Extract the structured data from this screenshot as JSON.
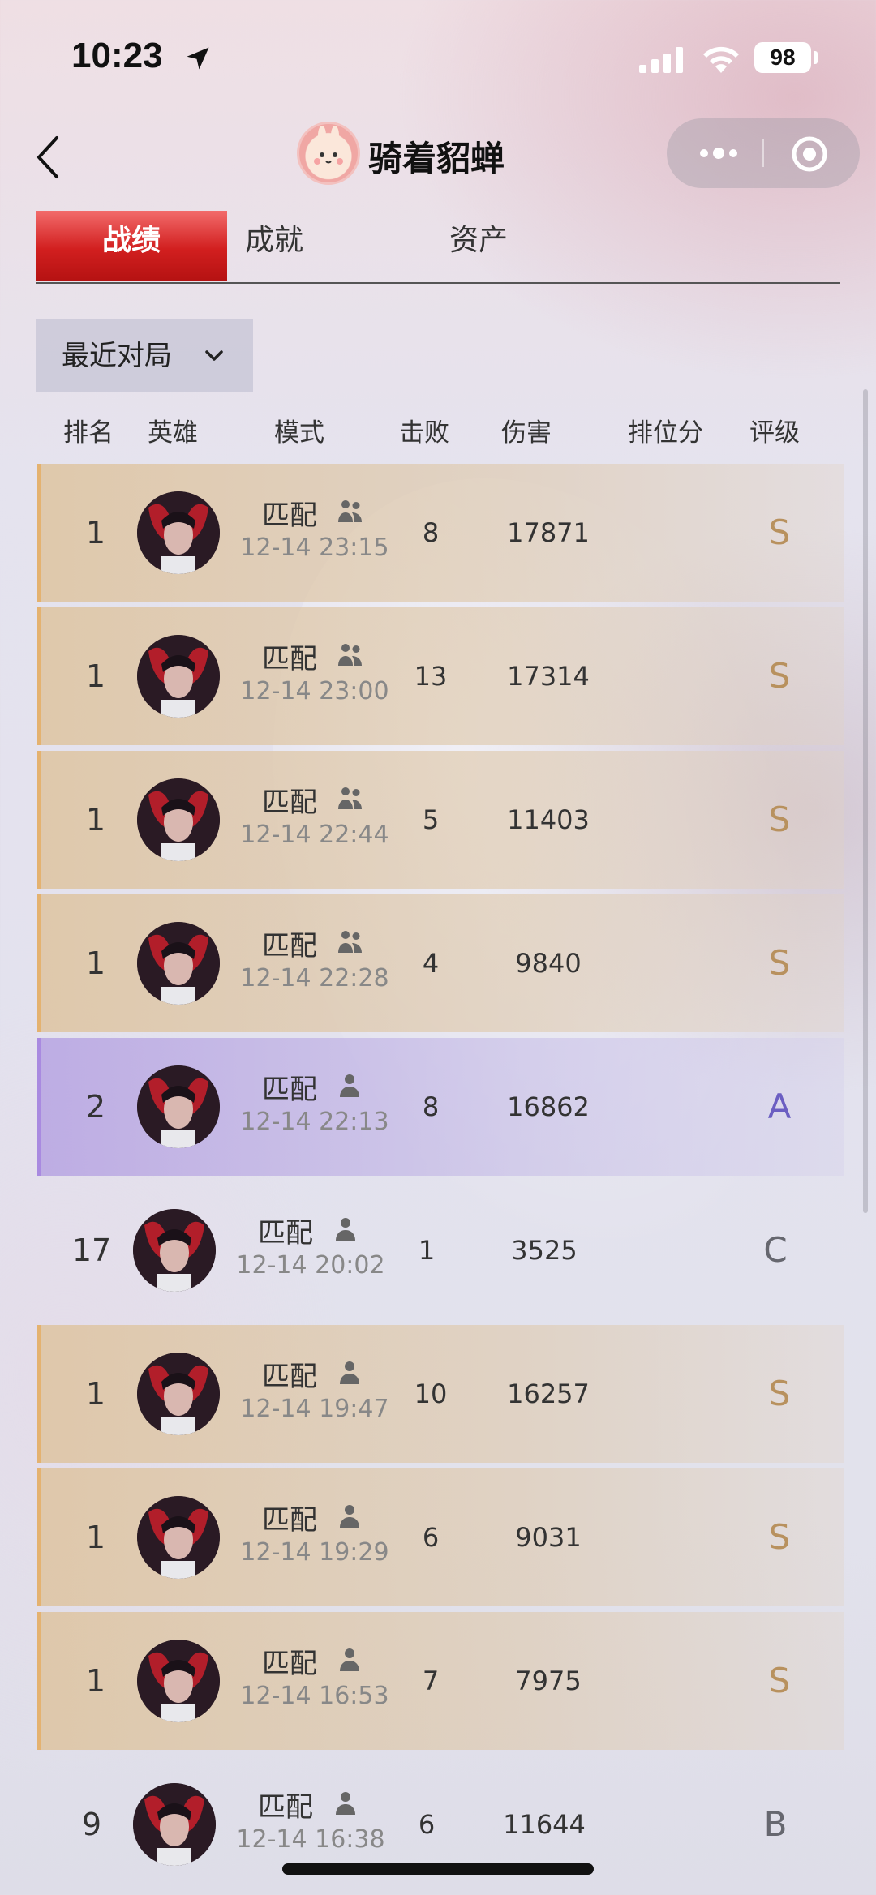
{
  "status_bar": {
    "time": "10:23",
    "battery": "98"
  },
  "nav": {
    "title": "骑着貂蝉"
  },
  "tabs": [
    "战绩",
    "成就",
    "资产"
  ],
  "filter": {
    "label": "最近对局"
  },
  "columns": {
    "rank": "排名",
    "hero": "英雄",
    "mode": "模式",
    "kills": "击败",
    "damage": "伤害",
    "rank_points": "排位分",
    "grade": "评级"
  },
  "matches": [
    {
      "rank": "1",
      "mode": "匹配",
      "team": "group",
      "time": "12-14 23:15",
      "kills": "8",
      "damage": "17871",
      "grade": "S",
      "style": "gold"
    },
    {
      "rank": "1",
      "mode": "匹配",
      "team": "group",
      "time": "12-14 23:00",
      "kills": "13",
      "damage": "17314",
      "grade": "S",
      "style": "gold"
    },
    {
      "rank": "1",
      "mode": "匹配",
      "team": "group",
      "time": "12-14 22:44",
      "kills": "5",
      "damage": "11403",
      "grade": "S",
      "style": "gold"
    },
    {
      "rank": "1",
      "mode": "匹配",
      "team": "group",
      "time": "12-14 22:28",
      "kills": "4",
      "damage": "9840",
      "grade": "S",
      "style": "gold"
    },
    {
      "rank": "2",
      "mode": "匹配",
      "team": "solo",
      "time": "12-14 22:13",
      "kills": "8",
      "damage": "16862",
      "grade": "A",
      "style": "purple"
    },
    {
      "rank": "17",
      "mode": "匹配",
      "team": "solo",
      "time": "12-14 20:02",
      "kills": "1",
      "damage": "3525",
      "grade": "C",
      "style": "plain"
    },
    {
      "rank": "1",
      "mode": "匹配",
      "team": "solo",
      "time": "12-14 19:47",
      "kills": "10",
      "damage": "16257",
      "grade": "S",
      "style": "gold"
    },
    {
      "rank": "1",
      "mode": "匹配",
      "team": "solo",
      "time": "12-14 19:29",
      "kills": "6",
      "damage": "9031",
      "grade": "S",
      "style": "gold"
    },
    {
      "rank": "1",
      "mode": "匹配",
      "team": "solo",
      "time": "12-14 16:53",
      "kills": "7",
      "damage": "7975",
      "grade": "S",
      "style": "gold"
    },
    {
      "rank": "9",
      "mode": "匹配",
      "team": "solo",
      "time": "12-14 16:38",
      "kills": "6",
      "damage": "11644",
      "grade": "B",
      "style": "plain"
    }
  ]
}
